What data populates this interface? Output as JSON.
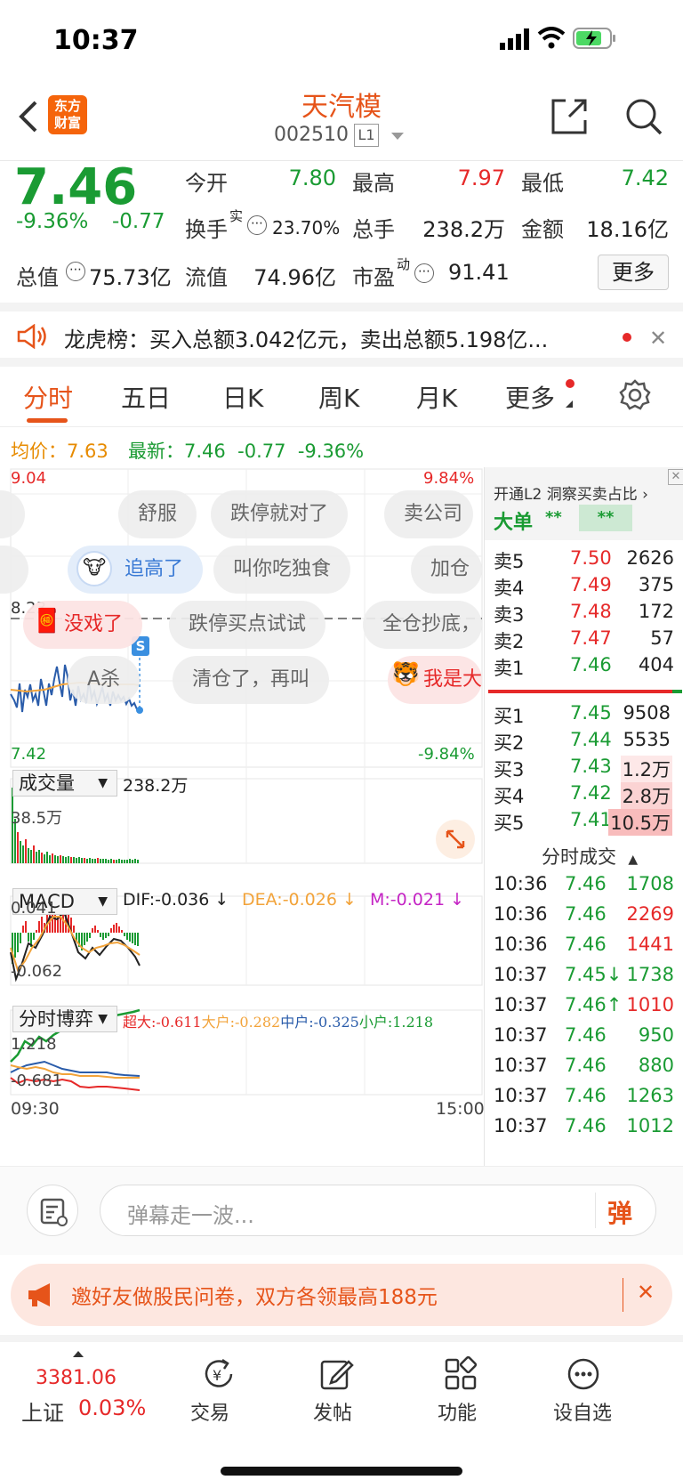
{
  "status": {
    "time": "10:37"
  },
  "nav": {
    "stock_name": "天汽模",
    "stock_code": "002510",
    "level_badge": "L1",
    "logo_line1": "东方",
    "logo_line2": "财富"
  },
  "quote": {
    "price": "7.46",
    "change_pct": "-9.36%",
    "change": "-0.77",
    "open_label": "今开",
    "open": "7.80",
    "high_label": "最高",
    "high": "7.97",
    "low_label": "最低",
    "low": "7.42",
    "turnover_label": "换手",
    "turnover_sup": "实",
    "turnover": "23.70%",
    "vol_label": "总手",
    "vol": "238.2万",
    "amount_label": "金额",
    "amount": "18.16亿",
    "mcap_label": "总值",
    "mcap": "75.73亿",
    "float_label": "流值",
    "float": "74.96亿",
    "pe_label": "市盈",
    "pe_sup": "动",
    "pe": "91.41",
    "more_button": "更多"
  },
  "dragon": {
    "text": "龙虎榜：买入总额3.042亿元，卖出总额5.198亿..."
  },
  "tabs": [
    "分时",
    "五日",
    "日K",
    "周K",
    "月K",
    "更多"
  ],
  "avgline": {
    "avg_label": "均价：",
    "avg": "7.63",
    "last_label": "最新：",
    "last": "7.46",
    "chg": "-0.77",
    "pct": "-9.36%"
  },
  "chart": {
    "ymax": "9.04",
    "ymax_pct": "9.84%",
    "ymid": "8.23",
    "ymin": "7.42",
    "ymin_pct": "-9.84%",
    "s_badge": "S",
    "bubbles": [
      "舒服",
      "跌停就对了",
      "卖公司",
      "追高了",
      "叫你吃独食",
      "加仓",
      "没戏了",
      "跌停买点试试",
      "全仓抄底，",
      "A杀",
      "清仓了，再叫",
      "我是大"
    ],
    "volume_select": "成交量",
    "volume_total": "238.2万",
    "volume_max": "38.5万",
    "macd_select": "MACD",
    "dif": "DIF:-0.036 ↓",
    "dea": "DEA:-0.026 ↓",
    "m": "M:-0.021 ↓",
    "macd_top": "0.041",
    "macd_bottom": "-0.062",
    "game_select": "分时博弈",
    "super": "超大:-0.611",
    "big": "大户:-0.282",
    "mid": "中户:-0.325",
    "small": "小户:1.218",
    "game_top": "1.218",
    "game_bottom": "-0.681",
    "time_start": "09:30",
    "time_end": "15:00",
    "colors": {
      "price": "#2a5caa",
      "avg": "#f2a33a",
      "up": "#e62929",
      "down": "#1a9b33"
    }
  },
  "orderbook": {
    "l2_text": "开通L2 洞察买卖占比",
    "big_label": "大单",
    "big_stars": "**",
    "big_stars2": "**",
    "sells": [
      {
        "label": "卖5",
        "price": "7.50",
        "vol": "2626"
      },
      {
        "label": "卖4",
        "price": "7.49",
        "vol": "375"
      },
      {
        "label": "卖3",
        "price": "7.48",
        "vol": "172"
      },
      {
        "label": "卖2",
        "price": "7.47",
        "vol": "57"
      },
      {
        "label": "卖1",
        "price": "7.46",
        "vol": "404"
      }
    ],
    "buys": [
      {
        "label": "买1",
        "price": "7.45",
        "vol": "9508"
      },
      {
        "label": "买2",
        "price": "7.44",
        "vol": "5535"
      },
      {
        "label": "买3",
        "price": "7.43",
        "vol": "1.2万"
      },
      {
        "label": "买4",
        "price": "7.42",
        "vol": "2.8万"
      },
      {
        "label": "买5",
        "price": "7.41",
        "vol": "10.5万"
      }
    ]
  },
  "ticks": {
    "title": "分时成交",
    "rows": [
      {
        "time": "10:36",
        "price": "7.46",
        "vol": "1708",
        "vc": "g"
      },
      {
        "time": "10:36",
        "price": "7.46",
        "vol": "2269",
        "vc": "r"
      },
      {
        "time": "10:36",
        "price": "7.46",
        "vol": "1441",
        "vc": "r"
      },
      {
        "time": "10:37",
        "price": "7.45↓",
        "vol": "1738",
        "vc": "g"
      },
      {
        "time": "10:37",
        "price": "7.46↑",
        "vol": "1010",
        "vc": "r"
      },
      {
        "time": "10:37",
        "price": "7.46",
        "vol": "950",
        "vc": "g"
      },
      {
        "time": "10:37",
        "price": "7.46",
        "vol": "880",
        "vc": "g"
      },
      {
        "time": "10:37",
        "price": "7.46",
        "vol": "1263",
        "vc": "g"
      },
      {
        "time": "10:37",
        "price": "7.46",
        "vol": "1012",
        "vc": "g"
      }
    ]
  },
  "comment": {
    "placeholder": "弹幕走一波...",
    "send_glyph": "弹"
  },
  "banner": {
    "text": "邀好友做股民问卷，双方各领最高188元"
  },
  "bottomnav": {
    "index_value": "3381.06",
    "index_name": "上证",
    "index_pct": "0.03%",
    "trade": "交易",
    "post": "发帖",
    "func": "功能",
    "watch": "设自选"
  }
}
